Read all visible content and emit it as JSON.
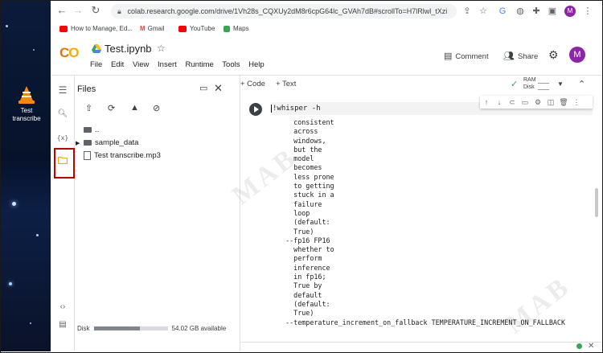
{
  "desktop": {
    "icon_label": "Test\ntranscribe",
    "icon_label_1": "Test",
    "icon_label_2": "transcribe"
  },
  "browser": {
    "url": "colab.research.google.com/drive/1Vh28s_CQXUy2dM8r6cpG64lc_GVAh7dB#scrollTo=H7lRlwl_tXzi",
    "bookmarks": [
      {
        "label": "How to Manage, Ed...",
        "color": "#ff0000"
      },
      {
        "label": "Gmail",
        "color": "#ea4335"
      },
      {
        "label": "YouTube",
        "color": "#ff0000"
      },
      {
        "label": "Maps",
        "color": "#34a853"
      }
    ],
    "profile_initial": "M"
  },
  "colab": {
    "logo": "CO",
    "notebook_title": "Test.ipynb",
    "menu": [
      "File",
      "Edit",
      "View",
      "Insert",
      "Runtime",
      "Tools",
      "Help"
    ],
    "comment_label": "Comment",
    "share_label": "Share",
    "profile_initial": "M"
  },
  "files_panel": {
    "title": "Files",
    "tree": [
      {
        "label": "..",
        "type": "up"
      },
      {
        "label": "sample_data",
        "type": "folder"
      },
      {
        "label": "Test transcribe.mp3",
        "type": "file"
      }
    ],
    "disk_label": "Disk",
    "disk_free": "54.02 GB available",
    "disk_used_fraction": 0.62
  },
  "notebook": {
    "add_code": "+ Code",
    "add_text": "+ Text",
    "ram_label": "RAM",
    "disk_label": "Disk",
    "cell_code": "!whisper -h",
    "output_lines": [
      "    consistent",
      "    across",
      "    windows,",
      "    but the",
      "    model",
      "    becomes",
      "    less prone",
      "    to getting",
      "    stuck in a",
      "    failure",
      "    loop",
      "    (default:",
      "    True)",
      "  --fp16 FP16",
      "    whether to",
      "    perform",
      "    inference",
      "    in fp16;",
      "    True by",
      "    default",
      "    (default:",
      "    True)",
      "  --temperature_increment_on_fallback TEMPERATURE_INCREMENT_ON_FALLBACK"
    ]
  },
  "watermark": "MAB",
  "colors": {
    "accent_orange": "#f9ab00",
    "highlight_red": "#c00000",
    "avatar_purple": "#8e24aa"
  }
}
